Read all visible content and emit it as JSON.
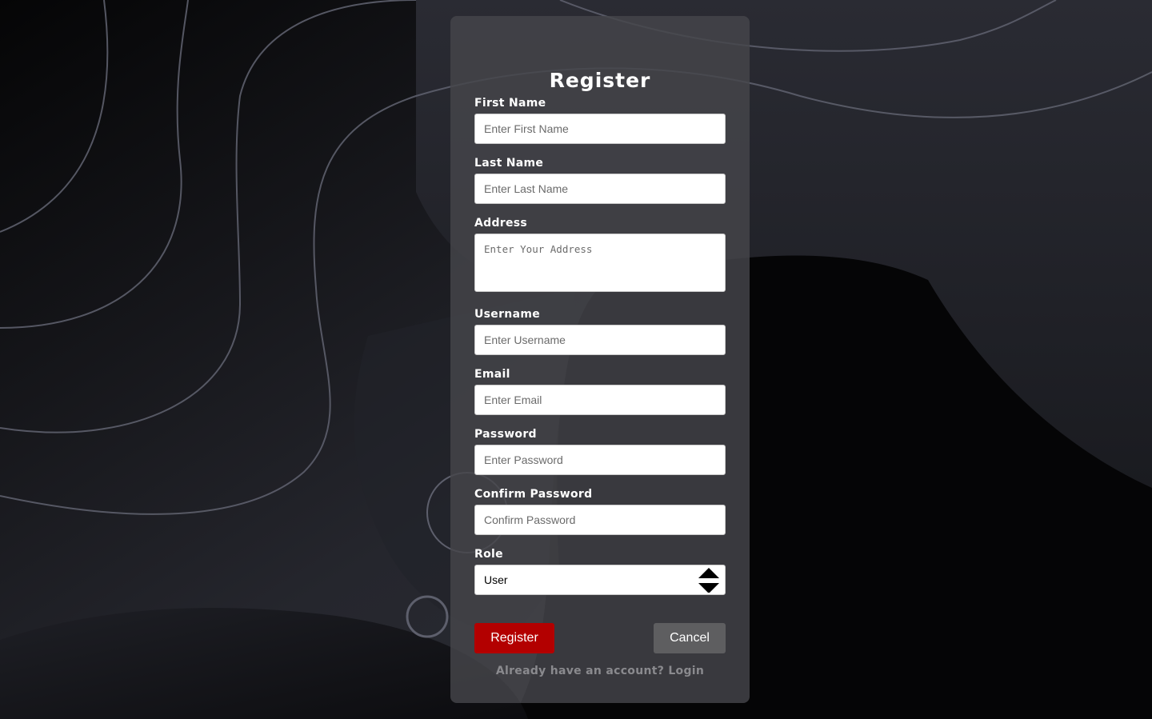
{
  "form": {
    "title": "Register",
    "fields": {
      "first_name": {
        "label": "First Name",
        "placeholder": "Enter First Name",
        "value": ""
      },
      "last_name": {
        "label": "Last Name",
        "placeholder": "Enter Last Name",
        "value": ""
      },
      "address": {
        "label": "Address",
        "placeholder": "Enter Your Address",
        "value": ""
      },
      "username": {
        "label": "Username",
        "placeholder": "Enter Username",
        "value": ""
      },
      "email": {
        "label": "Email",
        "placeholder": "Enter Email",
        "value": ""
      },
      "password": {
        "label": "Password",
        "placeholder": "Enter Password",
        "value": ""
      },
      "confirm_password": {
        "label": "Confirm Password",
        "placeholder": "Confirm Password",
        "value": ""
      },
      "role": {
        "label": "Role",
        "selected": "User"
      }
    },
    "buttons": {
      "register": "Register",
      "cancel": "Cancel"
    },
    "footer": {
      "text": "Already have an account? ",
      "link": "Login"
    }
  },
  "colors": {
    "register_button": "#b30000",
    "cancel_button": "#5e5e60",
    "card": "#46464a",
    "background": "#0b0b0d"
  }
}
